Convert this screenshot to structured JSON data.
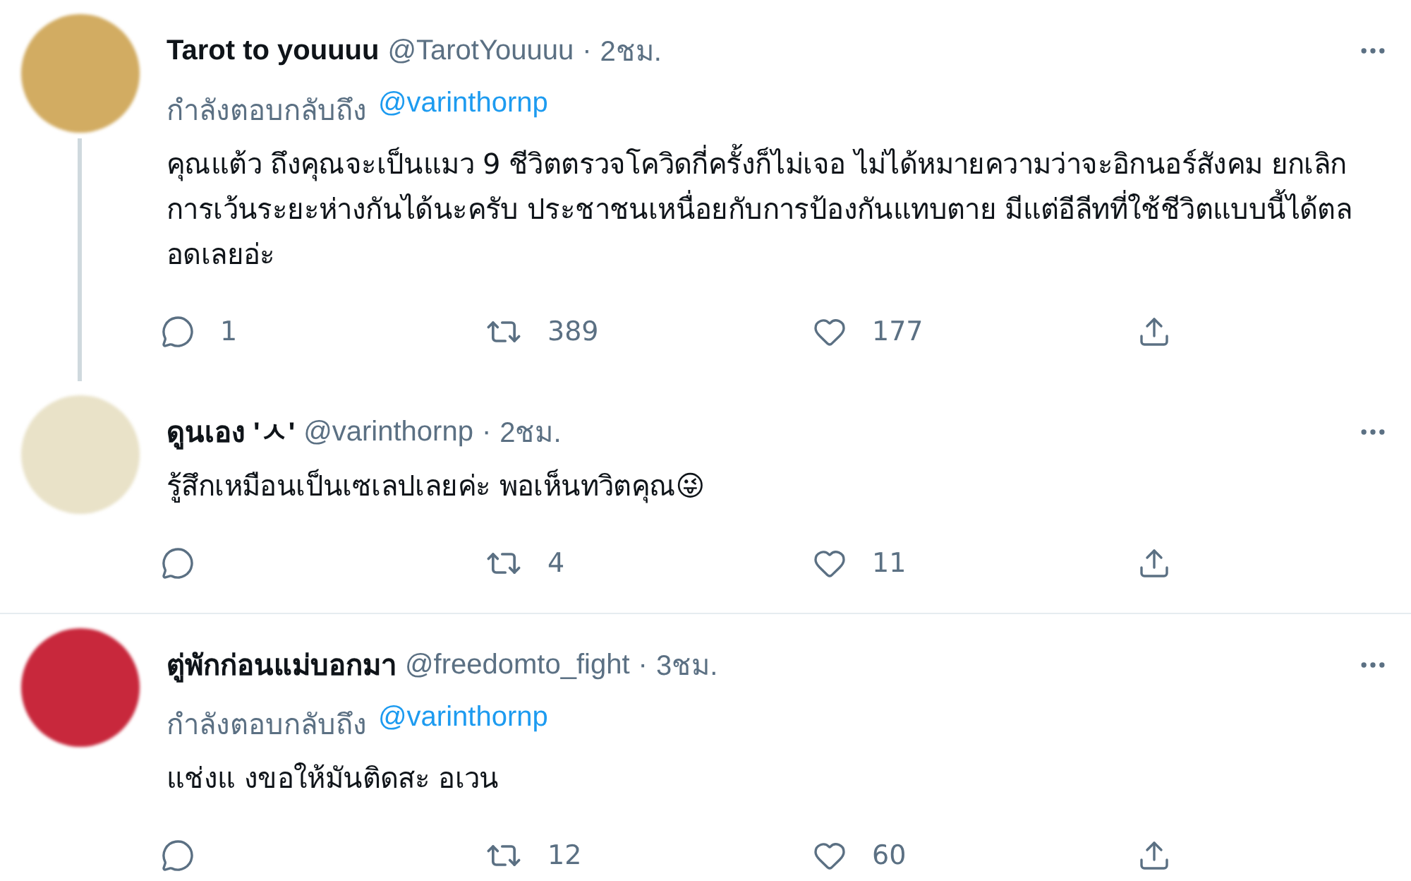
{
  "tweets": [
    {
      "display_name": "Tarot to youuuu",
      "handle": "@TarotYouuuu",
      "separator": "·",
      "time": "2ชม.",
      "color": "#d2ac62",
      "thread_line": true,
      "replying_to": {
        "prefix": "กำลังตอบกลับถึง",
        "handle": "@varinthornp"
      },
      "text": "คุณแต้ว ถึงคุณจะเป็นแมว 9 ชีวิตตรวจโควิดกี่ครั้งก็ไม่เจอ ไม่ได้หมายความว่าจะอิกนอร์สังคม ยกเลิกการเว้นระยะห่างกันได้นะครับ ประชาชนเหนื่อยกับการป้องกันแทบตาย มีแต่อีลีทที่ใช้ชีวิตแบบนี้ได้ตลอดเลยอ่ะ",
      "replies": "1",
      "retweets": "389",
      "likes": "177"
    },
    {
      "display_name": "ดูนเอง 'ㅅ'",
      "handle": "@varinthornp",
      "separator": "·",
      "time": "2ชม.",
      "color": "#e9e2c8",
      "thread_line": false,
      "text": "รู้สึกเหมือนเป็นเซเลปเลยค่ะ พอเห็นทวิตคุณ😜",
      "retweets": "4",
      "likes": "11"
    },
    {
      "display_name": "ตู่พักก่อนแม่บอกมา",
      "handle": "@freedomto_fight",
      "separator": "·",
      "time": "3ชม.",
      "color": "#c8283c",
      "thread_line": false,
      "replying_to": {
        "prefix": "กำลังตอบกลับถึง",
        "handle": "@varinthornp"
      },
      "text": "แช่งแ งขอให้มันติดสะ อเวน",
      "retweets": "12",
      "likes": "60"
    }
  ]
}
